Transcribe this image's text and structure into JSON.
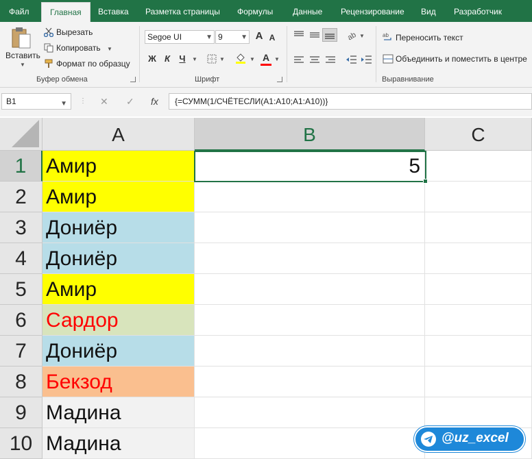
{
  "ribbon_tabs": [
    "Файл",
    "Главная",
    "Вставка",
    "Разметка страницы",
    "Формулы",
    "Данные",
    "Рецензирование",
    "Вид",
    "Разработчик"
  ],
  "clipboard": {
    "paste": "Вставить",
    "cut": "Вырезать",
    "copy": "Копировать",
    "format_painter": "Формат по образцу",
    "group_label": "Буфер обмена"
  },
  "font": {
    "name": "Segoe UI",
    "size": "9",
    "grow": "A",
    "shrink": "A",
    "bold": "Ж",
    "italic": "К",
    "underline": "Ч",
    "font_color": "A",
    "group_label": "Шрифт"
  },
  "alignment": {
    "wrap_text": "Переносить текст",
    "merge_center": "Объединить и поместить в центре",
    "group_label": "Выравнивание"
  },
  "formula_bar": {
    "name_box": "B1",
    "fx": "fx",
    "cancel": "✕",
    "enter": "✓",
    "formula": "{=СУММ(1/СЧЁТЕСЛИ(A1:A10;A1:A10))}"
  },
  "grid": {
    "columns": [
      "A",
      "B",
      "C"
    ],
    "rows": [
      {
        "num": "1",
        "a": "Амир",
        "b": "5"
      },
      {
        "num": "2",
        "a": "Амир",
        "b": ""
      },
      {
        "num": "3",
        "a": "Дониёр",
        "b": ""
      },
      {
        "num": "4",
        "a": "Дониёр",
        "b": ""
      },
      {
        "num": "5",
        "a": "Амир",
        "b": ""
      },
      {
        "num": "6",
        "a": "Сардор",
        "b": ""
      },
      {
        "num": "7",
        "a": "Дониёр",
        "b": ""
      },
      {
        "num": "8",
        "a": "Бекзод",
        "b": ""
      },
      {
        "num": "9",
        "a": "Мадина",
        "b": ""
      },
      {
        "num": "10",
        "a": "Мадина",
        "b": ""
      }
    ]
  },
  "badge": {
    "handle": "@uz_excel"
  },
  "colors": {
    "accent": "#217346",
    "fill_yellow": "#ffff00",
    "fill_blue": "#b7dde8",
    "fill_green": "#d8e4bc",
    "fill_orange": "#fabf8f",
    "fill_gray": "#f2f2f2",
    "text_red": "#ff0000",
    "badge": "#1e88d9"
  }
}
